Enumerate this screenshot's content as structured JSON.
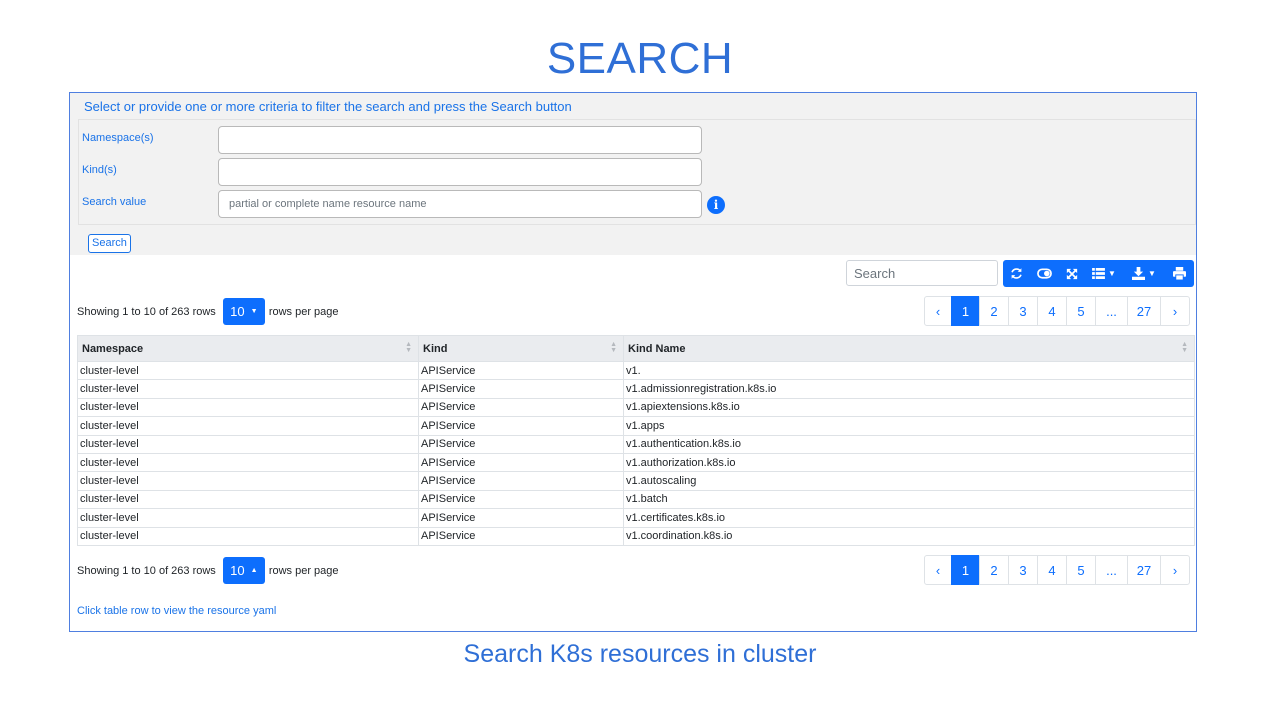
{
  "page_title": "SEARCH",
  "caption": "Search K8s resources in cluster",
  "criteria": {
    "instructions": "Select or provide one or more criteria to filter the search and press the Search button",
    "namespace_label": "Namespace(s)",
    "namespace_value": "",
    "kind_label": "Kind(s)",
    "kind_value": "",
    "search_value_label": "Search value",
    "search_value_placeholder": "partial or complete name resource name",
    "info_icon": "i",
    "search_button": "Search"
  },
  "table_toolbar": {
    "search_placeholder": "Search",
    "buttons": [
      "refresh-icon",
      "toggle-icon",
      "fullscreen-icon",
      "columns-icon",
      "export-icon",
      "print-icon"
    ]
  },
  "pagination": {
    "info_prefix": "Showing 1 to 10 of 263 rows",
    "page_size": "10",
    "info_suffix": "rows per page",
    "prev": "‹",
    "pages": [
      "1",
      "2",
      "3",
      "4",
      "5",
      "...",
      "27"
    ],
    "next": "›",
    "active_page": "1"
  },
  "table": {
    "columns": [
      "Namespace",
      "Kind",
      "Kind Name"
    ],
    "rows": [
      [
        "cluster-level",
        "APIService",
        "v1."
      ],
      [
        "cluster-level",
        "APIService",
        "v1.admissionregistration.k8s.io"
      ],
      [
        "cluster-level",
        "APIService",
        "v1.apiextensions.k8s.io"
      ],
      [
        "cluster-level",
        "APIService",
        "v1.apps"
      ],
      [
        "cluster-level",
        "APIService",
        "v1.authentication.k8s.io"
      ],
      [
        "cluster-level",
        "APIService",
        "v1.authorization.k8s.io"
      ],
      [
        "cluster-level",
        "APIService",
        "v1.autoscaling"
      ],
      [
        "cluster-level",
        "APIService",
        "v1.batch"
      ],
      [
        "cluster-level",
        "APIService",
        "v1.certificates.k8s.io"
      ],
      [
        "cluster-level",
        "APIService",
        "v1.coordination.k8s.io"
      ]
    ]
  },
  "footer_hint": "Click table row to view the resource yaml",
  "colors": {
    "accent": "#0d6efd",
    "title": "#2f6fd6",
    "link_text": "#1a73e8"
  }
}
